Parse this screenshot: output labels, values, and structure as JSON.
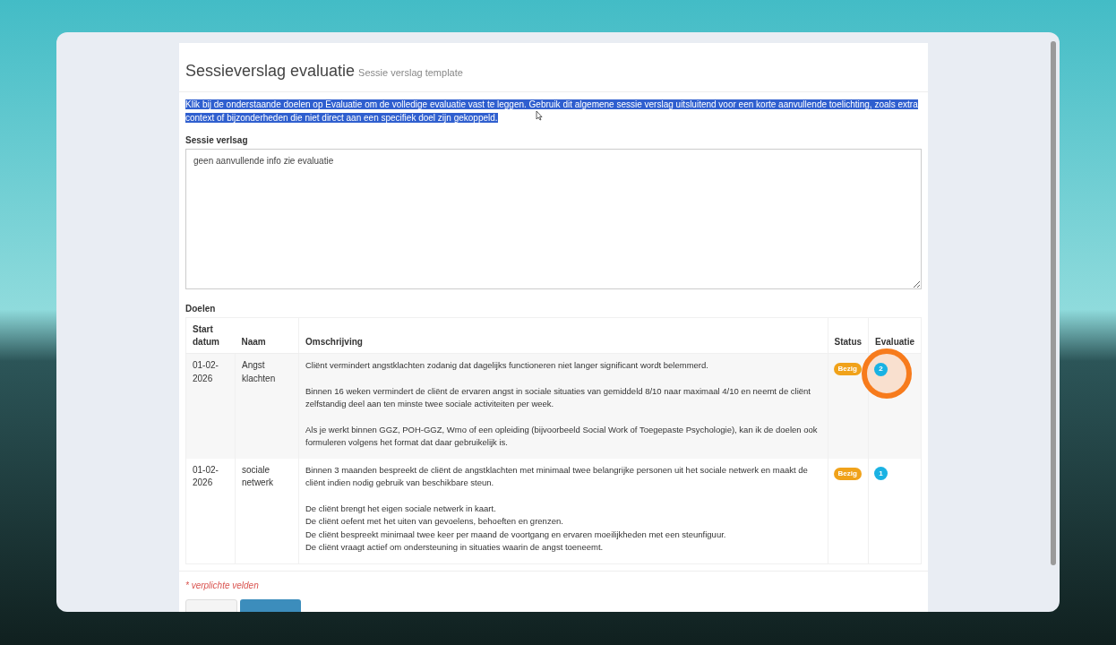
{
  "page": {
    "title": "Sessieverslag evaluatie",
    "subtitle": "Sessie verslag template"
  },
  "intro": {
    "text": "Klik bij de onderstaande doelen op Evaluatie om de volledige evaluatie vast te leggen. Gebruik dit algemene sessie verslag uitsluitend voor een korte aanvullende toelichting, zoals extra context of bijzonderheden die niet direct aan een specifiek doel zijn gekoppeld.",
    "selected": true
  },
  "report_field": {
    "label": "Sessie verlsag",
    "value": "geen aanvullende info zie evaluatie"
  },
  "goals": {
    "title": "Doelen",
    "columns": [
      "Start datum",
      "Naam",
      "Omschrijving",
      "Status",
      "Evaluatie"
    ],
    "rows": [
      {
        "start": "01-02-2026",
        "name": "Angst klachten",
        "description": [
          [
            "Cliënt vermindert angstklachten zodanig dat dagelijks functioneren niet langer significant wordt belemmerd."
          ],
          [
            "Binnen 16 weken vermindert de cliënt de ervaren angst in sociale situaties van gemiddeld 8/10 naar maximaal 4/10 en neemt de cliënt zelfstandig deel aan ten minste twee sociale activiteiten per week."
          ],
          [
            "Als je werkt binnen GGZ, POH-GGZ, Wmo of een opleiding (bijvoorbeeld Social Work of Toegepaste Psychologie), kan ik de doelen ook formuleren volgens het format dat daar gebruikelijk is."
          ]
        ],
        "status": "Bezig",
        "evaluations": "2",
        "click_marker": true
      },
      {
        "start": "01-02-2026",
        "name": "sociale netwerk",
        "description": [
          [
            "Binnen 3 maanden bespreekt de cliënt de angstklachten met minimaal twee belangrijke personen uit het sociale netwerk en maakt de cliënt indien nodig gebruik van beschikbare steun."
          ],
          [
            "De cliënt brengt het eigen sociale netwerk in kaart.",
            "De cliënt oefent met het uiten van gevoelens, behoeften en grenzen.",
            "De cliënt bespreekt minimaal twee keer per maand de voortgang en ervaren moeilijkheden met een steunfiguur.",
            "De cliënt vraagt actief om ondersteuning in situaties waarin de angst toeneemt."
          ]
        ],
        "status": "Bezig",
        "evaluations": "1",
        "click_marker": false
      }
    ]
  },
  "required_note": "* verplichte velden"
}
